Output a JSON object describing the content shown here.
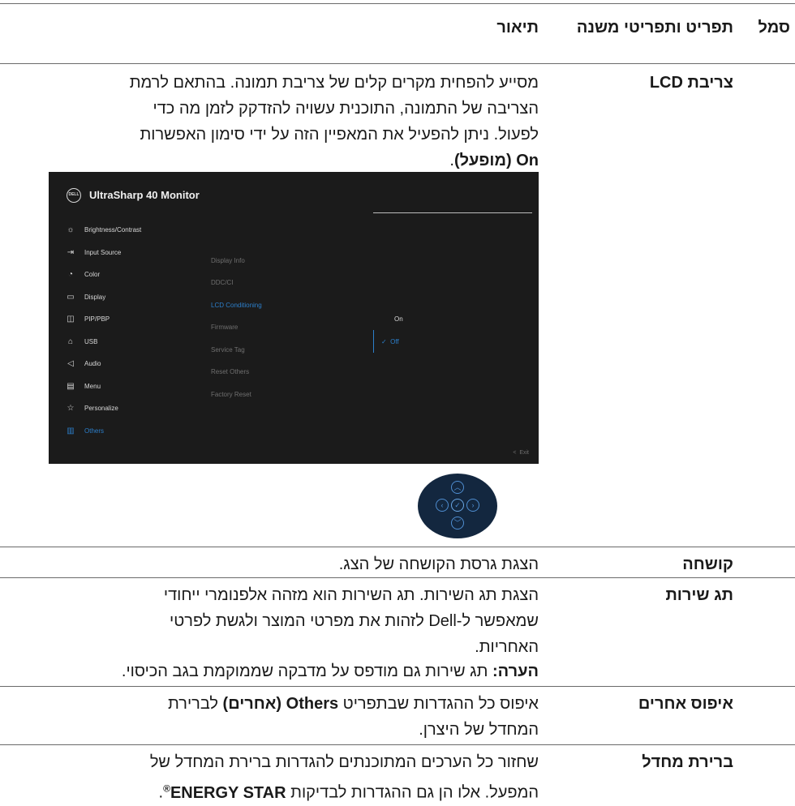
{
  "table_header": {
    "symbol": "סמל",
    "menu": "תפריט ותפריטי משנה",
    "description": "תיאור"
  },
  "rows": {
    "lcd": {
      "name": "צריבת LCD",
      "desc_line1": "מסייע להפחית מקרים קלים של צריבת תמונה. בהתאם לרמת",
      "desc_line2": "הצריבה של התמונה, התוכנית עשויה להזדקק לזמן מה כדי",
      "desc_line3": "לפעול. ניתן להפעיל את המאפיין הזה על ידי סימון האפשרות",
      "desc_bold": "On (מופעל)",
      "desc_end": "."
    },
    "firmware": {
      "name": "קושחה",
      "desc": "הצגת גרסת הקושחה של הצג."
    },
    "service_tag": {
      "name": "תג שירות",
      "desc_line1": "הצגת תג השירות. תג השירות הוא מזהה אלפנומרי ייחודי",
      "desc_line2": "שמאפשר ל-Dell לזהות את מפרטי המוצר ולגשת לפרטי",
      "desc_line3": "האחריות.",
      "note_label": "הערה:",
      "note_text": " תג שירות גם מודפס על מדבקה שממוקמת בגב הכיסוי."
    },
    "reset_others": {
      "name": "איפוס אחרים",
      "desc_a": "איפוס כל ההגדרות שבתפריט ",
      "desc_bold": "Others (אחרים)",
      "desc_b": " לברירת",
      "desc_line2": "המחדל של היצרן."
    },
    "factory_reset": {
      "name": "ברירת מחדל",
      "desc_line1": "שחזור כל הערכים המתוכנתים להגדרות ברירת המחדל של",
      "desc_a": "המפעל. אלו הן גם ההגדרות לבדיקות ",
      "desc_bold": "ENERGY STAR",
      "desc_sup": "®",
      "desc_end": "."
    }
  },
  "osd": {
    "logo": "DELL",
    "title": "UltraSharp 40 Monitor",
    "menu": [
      {
        "label": "Brightness/Contrast",
        "icon": "sun-icon"
      },
      {
        "label": "Input Source",
        "icon": "input-icon"
      },
      {
        "label": "Color",
        "icon": "palette-icon"
      },
      {
        "label": "Display",
        "icon": "monitor-icon"
      },
      {
        "label": "PIP/PBP",
        "icon": "pip-icon"
      },
      {
        "label": "USB",
        "icon": "usb-icon"
      },
      {
        "label": "Audio",
        "icon": "speaker-icon"
      },
      {
        "label": "Menu",
        "icon": "menu-icon"
      },
      {
        "label": "Personalize",
        "icon": "star-icon"
      },
      {
        "label": "Others",
        "icon": "others-icon"
      }
    ],
    "submenu": [
      "Display Info",
      "DDC/CI",
      "LCD Conditioning",
      "Firmware",
      "Service Tag",
      "Reset Others",
      "Factory Reset"
    ],
    "options": {
      "on": "On",
      "off": "Off"
    },
    "exit": "Exit",
    "accent_color": "#2c7fcb"
  }
}
